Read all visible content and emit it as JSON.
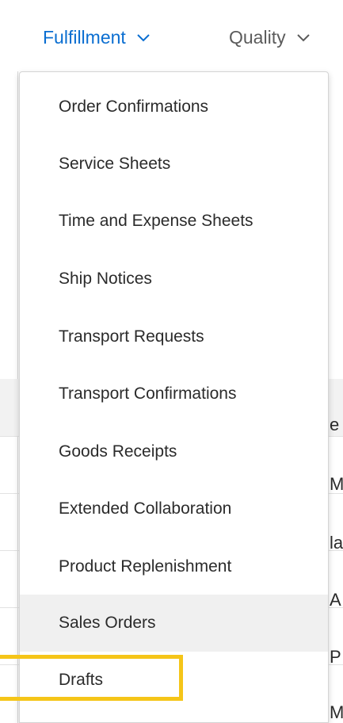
{
  "nav": {
    "tabs": [
      {
        "label": "Fulfillment",
        "active": true,
        "color": "#0a6ed1"
      },
      {
        "label": "Quality",
        "active": false,
        "color": "#5b5b5b"
      }
    ]
  },
  "menu": {
    "items": [
      {
        "label": "Order Confirmations"
      },
      {
        "label": "Service Sheets"
      },
      {
        "label": "Time and Expense Sheets"
      },
      {
        "label": "Ship Notices"
      },
      {
        "label": "Transport Requests"
      },
      {
        "label": "Transport Confirmations"
      },
      {
        "label": "Goods Receipts"
      },
      {
        "label": "Extended Collaboration"
      },
      {
        "label": "Product Replenishment"
      },
      {
        "label": "Sales Orders",
        "hovered": true
      },
      {
        "label": "Drafts",
        "highlighted": true
      }
    ]
  },
  "background": {
    "fragments": [
      "e",
      "M",
      "la",
      "A",
      "P",
      "M"
    ]
  },
  "colors": {
    "highlight": "#f5c518",
    "hover": "#f0f0f0"
  }
}
